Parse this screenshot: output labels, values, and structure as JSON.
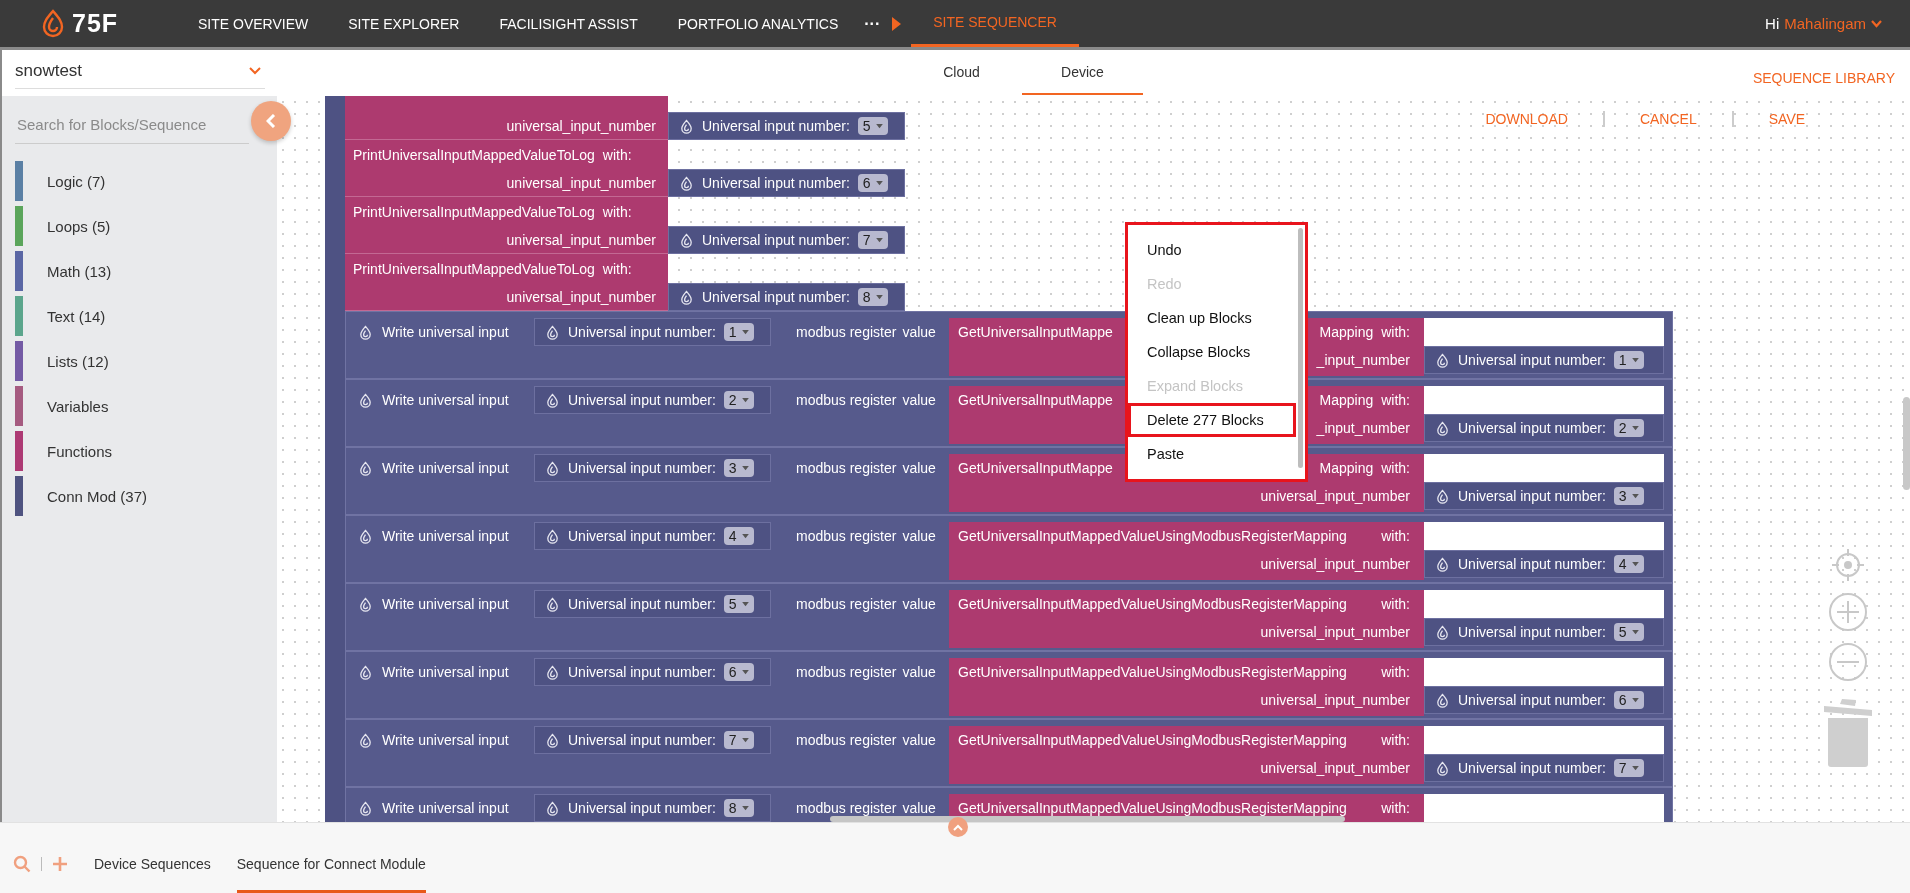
{
  "nav": {
    "logo": "75F",
    "items": [
      {
        "label": "SITE OVERVIEW",
        "selected": false
      },
      {
        "label": "SITE EXPLORER",
        "selected": false
      },
      {
        "label": "FACILISIGHT ASSIST",
        "selected": false
      },
      {
        "label": "PORTFOLIO ANALYTICS",
        "selected": false
      },
      {
        "label": "SITE SEQUENCER",
        "selected": true
      }
    ],
    "more": "···",
    "greeting": "Hi",
    "user": "Mahalingam"
  },
  "site_select": {
    "value": "snowtest"
  },
  "mode_tabs": [
    {
      "label": "Cloud",
      "selected": false
    },
    {
      "label": "Device",
      "selected": true
    }
  ],
  "sequence_library": "SEQUENCE LIBRARY",
  "sidebar": {
    "search": {
      "placeholder": "Search for Blocks/Sequence"
    },
    "categories": [
      {
        "label": "Logic (7)",
        "color": "#5b80a5"
      },
      {
        "label": "Loops (5)",
        "color": "#5ba55b"
      },
      {
        "label": "Math (13)",
        "color": "#5b67a5"
      },
      {
        "label": "Text (14)",
        "color": "#5ba58c"
      },
      {
        "label": "Lists (12)",
        "color": "#745ba5"
      },
      {
        "label": "Variables",
        "color": "#a55b80"
      },
      {
        "label": "Functions",
        "color": "#ad3a74"
      },
      {
        "label": "Conn Mod (37)",
        "color": "#4f5380"
      }
    ]
  },
  "actions": [
    "DOWNLOAD",
    "CANCEL",
    "SAVE"
  ],
  "print_blocks": [
    {
      "param": "universal_input_number",
      "number_label": "Universal input number:",
      "number": "5"
    },
    {
      "title": "PrintUniversalInputMappedValueToLog",
      "with": "with:",
      "param": "universal_input_number",
      "number_label": "Universal input number:",
      "number": "6"
    },
    {
      "title": "PrintUniversalInputMappedValueToLog",
      "with": "with:",
      "param": "universal_input_number",
      "number_label": "Universal input number:",
      "number": "7"
    },
    {
      "title": "PrintUniversalInputMappedValueToLog",
      "with": "with:",
      "param": "universal_input_number",
      "number_label": "Universal input number:",
      "number": "8"
    }
  ],
  "write_blocks": [
    {
      "label": "Write universal input",
      "number_label": "Universal input number:",
      "number": "1",
      "register": "modbus register",
      "value": "value",
      "get_title": [
        "GetUniversalInputMappe",
        "Mapping",
        "with:"
      ],
      "param": "_input_number",
      "param_number_label": "Universal input number:",
      "param_number": "1"
    },
    {
      "label": "Write universal input",
      "number_label": "Universal input number:",
      "number": "2",
      "register": "modbus register",
      "value": "value",
      "get_title": [
        "GetUniversalInputMappe",
        "Mapping",
        "with:"
      ],
      "param": "_input_number",
      "param_number_label": "Universal input number:",
      "param_number": "2"
    },
    {
      "label": "Write universal input",
      "number_label": "Universal input number:",
      "number": "3",
      "register": "modbus register",
      "value": "value",
      "get_title": [
        "GetUniversalInputMappe",
        "Mapping",
        "with:"
      ],
      "param": "universal_input_number",
      "param_number_label": "Universal input number:",
      "param_number": "3"
    },
    {
      "label": "Write universal input",
      "number_label": "Universal input number:",
      "number": "4",
      "register": "modbus register",
      "value": "value",
      "get_title": [
        "GetUniversalInputMappedValueUsingModbusRegisterMapping",
        "with:"
      ],
      "param": "universal_input_number",
      "param_number_label": "Universal input number:",
      "param_number": "4"
    },
    {
      "label": "Write universal input",
      "number_label": "Universal input number:",
      "number": "5",
      "register": "modbus register",
      "value": "value",
      "get_title": [
        "GetUniversalInputMappedValueUsingModbusRegisterMapping",
        "with:"
      ],
      "param": "universal_input_number",
      "param_number_label": "Universal input number:",
      "param_number": "5"
    },
    {
      "label": "Write universal input",
      "number_label": "Universal input number:",
      "number": "6",
      "register": "modbus register",
      "value": "value",
      "get_title": [
        "GetUniversalInputMappedValueUsingModbusRegisterMapping",
        "with:"
      ],
      "param": "universal_input_number",
      "param_number_label": "Universal input number:",
      "param_number": "6"
    },
    {
      "label": "Write universal input",
      "number_label": "Universal input number:",
      "number": "7",
      "register": "modbus register",
      "value": "value",
      "get_title": [
        "GetUniversalInputMappedValueUsingModbusRegisterMapping",
        "with:"
      ],
      "param": "universal_input_number",
      "param_number_label": "Universal input number:",
      "param_number": "7"
    },
    {
      "label": "Write universal input",
      "number_label": "Universal input number:",
      "number": "8",
      "register": "modbus register",
      "value": "value",
      "get_title": [
        "GetUniversalInputMappedValueUsingModbusRegisterMapping",
        "with:"
      ]
    }
  ],
  "context_menu": [
    {
      "label": "Undo",
      "disabled": false,
      "highlighted": false
    },
    {
      "label": "Redo",
      "disabled": true,
      "highlighted": false
    },
    {
      "label": "Clean up Blocks",
      "disabled": false,
      "highlighted": false
    },
    {
      "label": "Collapse Blocks",
      "disabled": false,
      "highlighted": false
    },
    {
      "label": "Expand Blocks",
      "disabled": true,
      "highlighted": false
    },
    {
      "label": "Delete 277 Blocks",
      "disabled": false,
      "highlighted": true
    },
    {
      "label": "Paste",
      "disabled": false,
      "highlighted": false
    }
  ],
  "bottom_tabs": [
    {
      "label": "Device Sequences",
      "selected": false
    },
    {
      "label": "Sequence for Connect Module",
      "selected": true
    }
  ]
}
